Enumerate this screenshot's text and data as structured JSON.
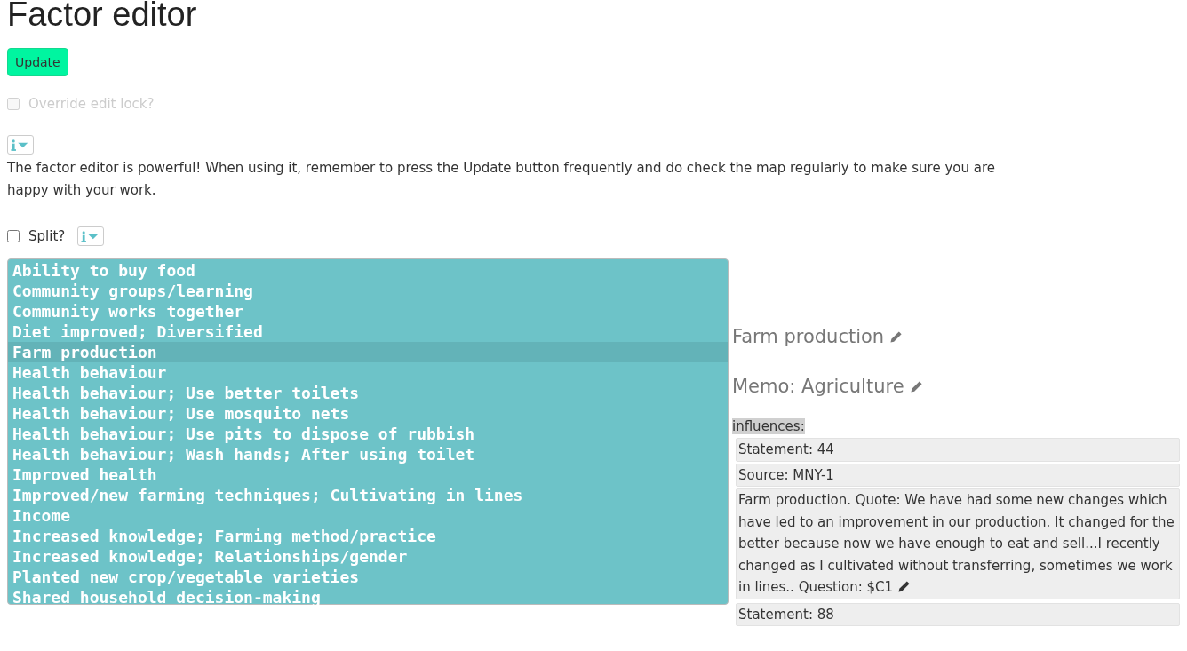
{
  "title": "Factor editor",
  "update_button": "Update",
  "override_lock": {
    "label": "Override edit lock?",
    "checked": false,
    "disabled": true
  },
  "info_text": "The factor editor is powerful! When using it, remember to press the Update button frequently and do check the map regularly to make sure you are happy with your work.",
  "split": {
    "label": "Split?",
    "checked": false
  },
  "factors": [
    {
      "label": "Ability to buy food",
      "selected": false
    },
    {
      "label": "Community groups/learning",
      "selected": false
    },
    {
      "label": "Community works together",
      "selected": false
    },
    {
      "label": "Diet improved; Diversified",
      "selected": false
    },
    {
      "label": "Farm production",
      "selected": true
    },
    {
      "label": "Health behaviour",
      "selected": false
    },
    {
      "label": "Health behaviour; Use better toilets",
      "selected": false
    },
    {
      "label": "Health behaviour; Use mosquito nets",
      "selected": false
    },
    {
      "label": "Health behaviour; Use pits to dispose of rubbish",
      "selected": false
    },
    {
      "label": "Health behaviour; Wash hands; After using toilet",
      "selected": false
    },
    {
      "label": "Improved health",
      "selected": false
    },
    {
      "label": "Improved/new farming techniques; Cultivating in lines",
      "selected": false
    },
    {
      "label": "Income",
      "selected": false
    },
    {
      "label": "Increased knowledge; Farming method/practice",
      "selected": false
    },
    {
      "label": "Increased knowledge; Relationships/gender",
      "selected": false
    },
    {
      "label": "Planted new crop/vegetable varieties",
      "selected": false
    },
    {
      "label": "Shared household decision-making",
      "selected": false
    }
  ],
  "detail": {
    "factor_name": "Farm production",
    "memo": "Memo: Agriculture",
    "influences_label": "influences:",
    "links": [
      {
        "statement": "Statement: 44",
        "source": "Source: MNY-1",
        "quote": "Farm production. Quote: We have had some new changes which have led to an improvement in our production. It changed for the better because now we have enough to eat and sell...I recently changed as I cultivated without transferring, sometimes we work in lines.. Question: $C1"
      },
      {
        "statement": "Statement: 88"
      }
    ]
  }
}
